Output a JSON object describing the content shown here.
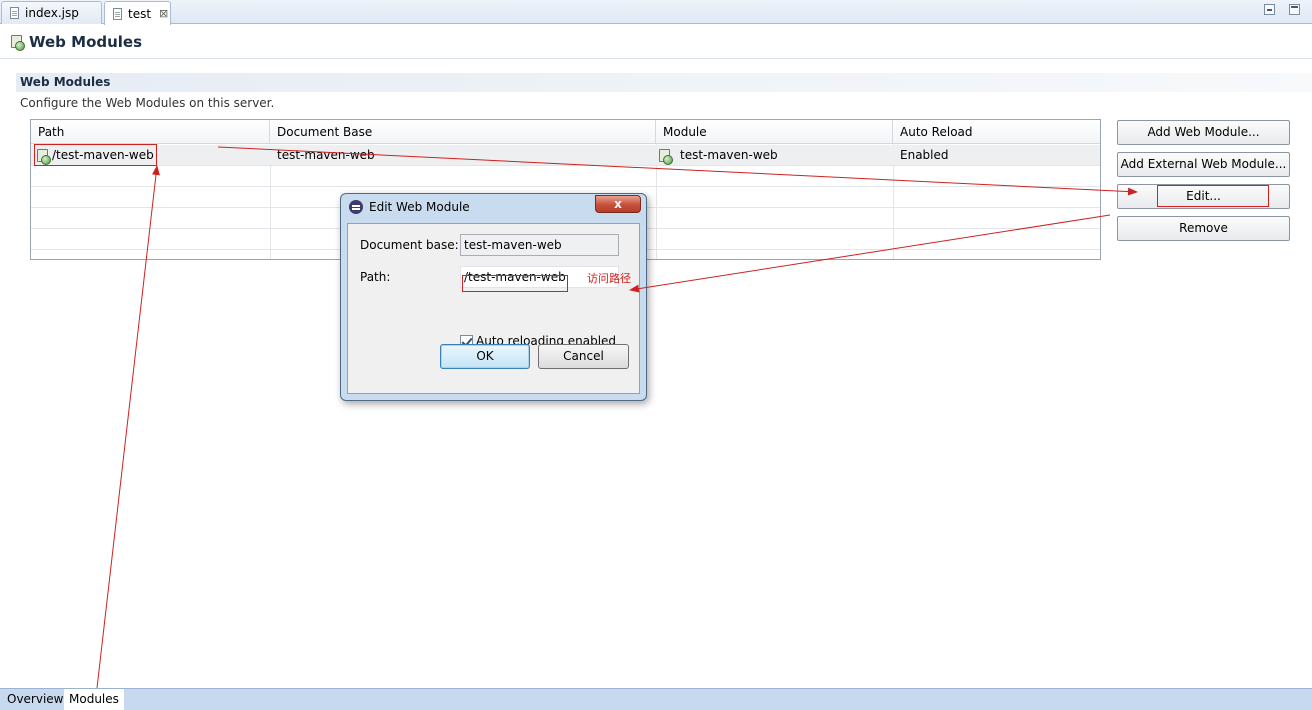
{
  "tabs": [
    {
      "label": "index.jsp",
      "closable": false,
      "active": false
    },
    {
      "label": "test",
      "closable": true,
      "active": true,
      "close_glyph": "⊠"
    }
  ],
  "page": {
    "title": "Web Modules"
  },
  "section": {
    "title": "Web Modules",
    "description": "Configure the Web Modules on this server."
  },
  "table": {
    "columns": [
      "Path",
      "Document Base",
      "Module",
      "Auto Reload"
    ],
    "rows": [
      {
        "path": "/test-maven-web",
        "document_base": "test-maven-web",
        "module": "test-maven-web",
        "auto_reload": "Enabled"
      }
    ]
  },
  "buttons": {
    "add_web_module": "Add Web Module...",
    "add_external": "Add External Web Module...",
    "edit": "Edit...",
    "remove": "Remove"
  },
  "dialog": {
    "title": "Edit Web Module",
    "close_glyph": "x",
    "doc_base_label": "Document base:",
    "doc_base_value": "test-maven-web",
    "path_label": "Path:",
    "path_value": "/test-maven-web",
    "auto_reload_label": "Auto reloading enabled",
    "auto_reload_checked": true,
    "ok_label": "OK",
    "cancel_label": "Cancel"
  },
  "annotation": {
    "text": "访问路径",
    "color": "#d02020"
  },
  "bottom_tabs": [
    {
      "label": "Overview",
      "active": false
    },
    {
      "label": "Modules",
      "active": true
    }
  ],
  "colors": {
    "annotation_red": "#d02020",
    "header_blue": "#c7d9ee"
  }
}
